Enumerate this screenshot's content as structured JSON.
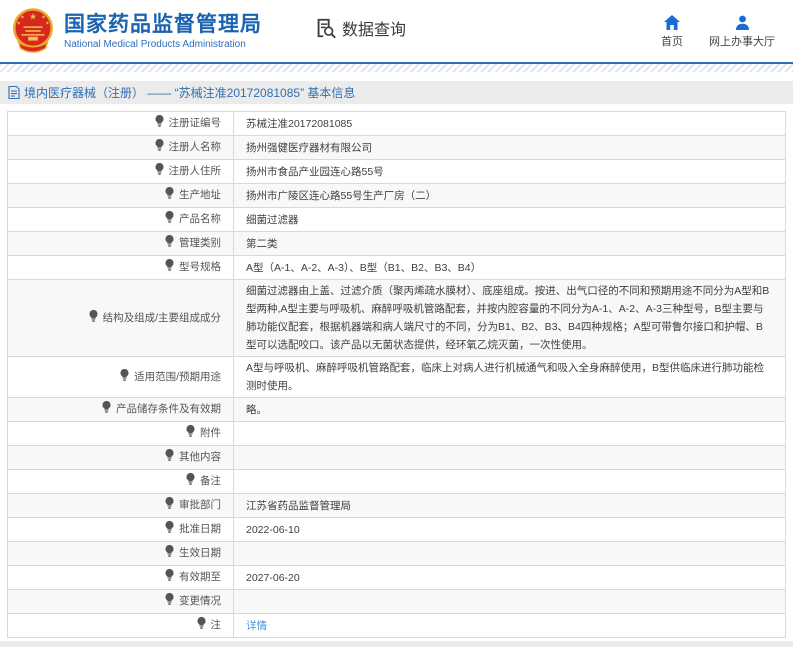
{
  "header": {
    "org_title": "国家药品监督管理局",
    "org_subtitle": "National Medical Products Administration",
    "data_query_label": "数据查询",
    "nav_home_label": "首页",
    "nav_service_hall_label": "网上办事大厅"
  },
  "breadcrumb": {
    "text": "境内医疗器械（注册） —— “苏械注准20172081085” 基本信息"
  },
  "table": {
    "rows": [
      {
        "label": "注册证编号",
        "value": "苏械注准20172081085"
      },
      {
        "label": "注册人名称",
        "value": "扬州强健医疗器材有限公司"
      },
      {
        "label": "注册人住所",
        "value": "扬州市食品产业园连心路55号"
      },
      {
        "label": "生产地址",
        "value": "扬州市广陵区连心路55号生产厂房（二）"
      },
      {
        "label": "产品名称",
        "value": "细菌过滤器"
      },
      {
        "label": "管理类别",
        "value": "第二类"
      },
      {
        "label": "型号规格",
        "value": "A型（A-1、A-2、A-3）、B型（B1、B2、B3、B4）"
      },
      {
        "label": "结构及组成/主要组成成分",
        "value": "细菌过滤器由上盖、过滤介质（聚丙烯疏水膜材）、底座组成。按进、出气口径的不同和预期用途不同分为A型和B型两种,A型主要与呼吸机、麻醉呼吸机管路配套，并按内腔容量的不同分为A-1、A-2、A-3三种型号，B型主要与肺功能仪配套，根据机器端和病人端尺寸的不同，分为B1、B2、B3、B4四种规格；A型可带鲁尔接口和护帽、B型可以选配咬口。该产品以无菌状态提供，经环氧乙烷灭菌，一次性使用。"
      },
      {
        "label": "适用范围/预期用途",
        "value": "A型与呼吸机、麻醉呼吸机管路配套，临床上对病人进行机械通气和吸入全身麻醉使用，B型供临床进行肺功能检测时使用。"
      },
      {
        "label": "产品储存条件及有效期",
        "value": "略。"
      },
      {
        "label": "附件",
        "value": ""
      },
      {
        "label": "其他内容",
        "value": ""
      },
      {
        "label": "备注",
        "value": ""
      },
      {
        "label": "审批部门",
        "value": "江苏省药品监督管理局"
      },
      {
        "label": "批准日期",
        "value": "2022-06-10"
      },
      {
        "label": "生效日期",
        "value": ""
      },
      {
        "label": "有效期至",
        "value": "2027-06-20"
      },
      {
        "label": "变更情况",
        "value": ""
      },
      {
        "label": "注",
        "value": "详情",
        "is_link": true,
        "has_note_icon": true
      }
    ]
  },
  "colors": {
    "brand_blue": "#1b63ae",
    "nav_icon_blue": "#1a6bd8",
    "link_blue": "#4b94dc",
    "breadcrumb_bg": "#ebebeb",
    "row_alt_bg": "#f8f8f8",
    "border_gray": "#d9d9d9"
  }
}
